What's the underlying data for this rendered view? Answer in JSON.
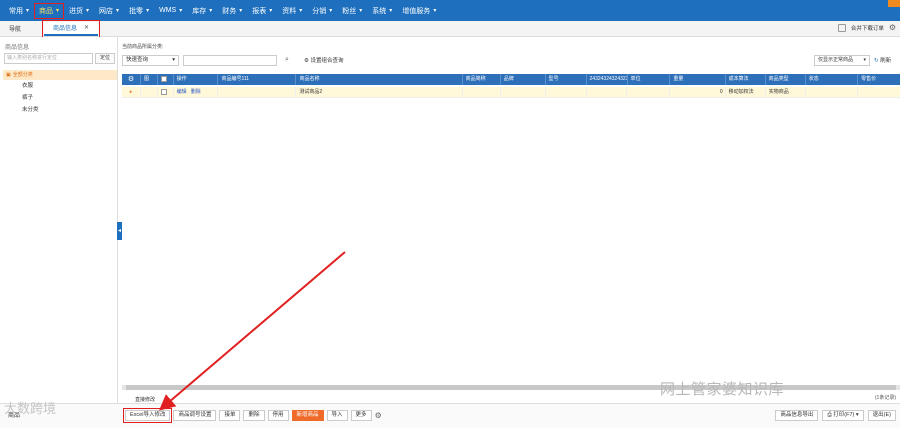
{
  "menubar": {
    "items": [
      "常用",
      "商品",
      "进货",
      "网店",
      "批零",
      "WMS",
      "库存",
      "财务",
      "报表",
      "资料",
      "分销",
      "粉丝",
      "系统",
      "增值服务"
    ]
  },
  "tabbar": {
    "nav_label": "导航",
    "active_tab_label": "商品信息",
    "right_label": "合并下载订单"
  },
  "sidebar": {
    "title": "商品信息",
    "search_placeholder": "输入类别名称进行定位",
    "locate_button": "定位",
    "tree": {
      "root": "全部分类",
      "children": [
        "衣服",
        "裤子",
        "未分类"
      ]
    }
  },
  "toolbar": {
    "category_label": "当前商品所属分类:",
    "quick_query": "快速查询",
    "combo_query": "设置组合查询",
    "filter_value": "仅显示正常商品",
    "refresh": "刷新"
  },
  "grid": {
    "columns": [
      "",
      "图",
      "",
      "操作",
      "商品编号111",
      "商品名称",
      "商品简称",
      "品牌",
      "型号",
      "24324324324323",
      "单位",
      "重量",
      "成本算法",
      "商品类型",
      "状态",
      "零售价"
    ],
    "rows": [
      {
        "edit": "编辑",
        "delete": "删除",
        "name": "测试商品2",
        "weight": "0",
        "cost_method": "移动加权法",
        "type": "实物商品"
      }
    ],
    "batch_edit": "直接修改",
    "record_count": "(1条记录)"
  },
  "bottombar": {
    "left_label": "商品",
    "buttons": [
      "Excel导入修改",
      "商品调号设置",
      "接单",
      "删除",
      "停用",
      "新增商品",
      "导入",
      "更多"
    ],
    "export": "商品信息导出",
    "print": "打印(F7)",
    "exit": "退出(E)"
  },
  "watermarks": {
    "right": "网上管家婆知识库",
    "left": "大数跨境"
  },
  "colors": {
    "brand": "#1e6fbe",
    "accent": "#f06a2a",
    "highlight": "#e02020"
  }
}
